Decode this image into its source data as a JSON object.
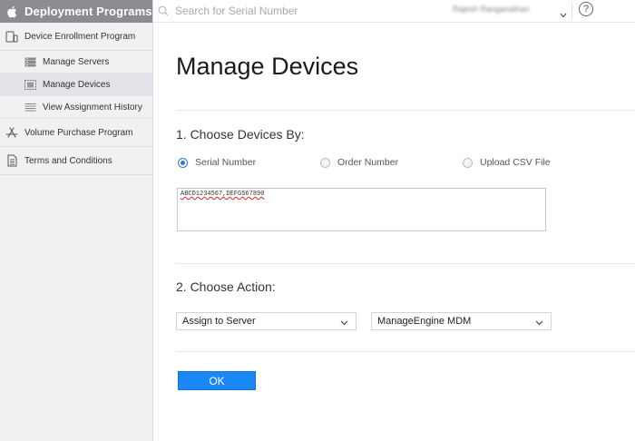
{
  "sidebar": {
    "title": "Deployment Programs",
    "items": [
      {
        "label": "Device Enrollment Program"
      },
      {
        "label": "Manage Servers"
      },
      {
        "label": "Manage Devices"
      },
      {
        "label": "View Assignment History"
      },
      {
        "label": "Volume Purchase Program"
      },
      {
        "label": "Terms and Conditions"
      }
    ]
  },
  "topbar": {
    "search_placeholder": "Search for Serial Number",
    "user_name": "Rajesh Ranganathan",
    "help_label": "?"
  },
  "main": {
    "title": "Manage Devices",
    "section1_title": "1. Choose Devices By:",
    "options": [
      {
        "label": "Serial Number",
        "selected": true
      },
      {
        "label": "Order Number",
        "selected": false
      },
      {
        "label": "Upload CSV File",
        "selected": false
      }
    ],
    "serial_value": "ABCD1234567,DEFG567890",
    "section2_title": "2. Choose Action:",
    "action_select": "Assign to Server",
    "server_select": "ManageEngine MDM",
    "ok_label": "OK"
  },
  "colors": {
    "sidebar_header": "#8b8b91",
    "accent": "#1a87f5"
  }
}
